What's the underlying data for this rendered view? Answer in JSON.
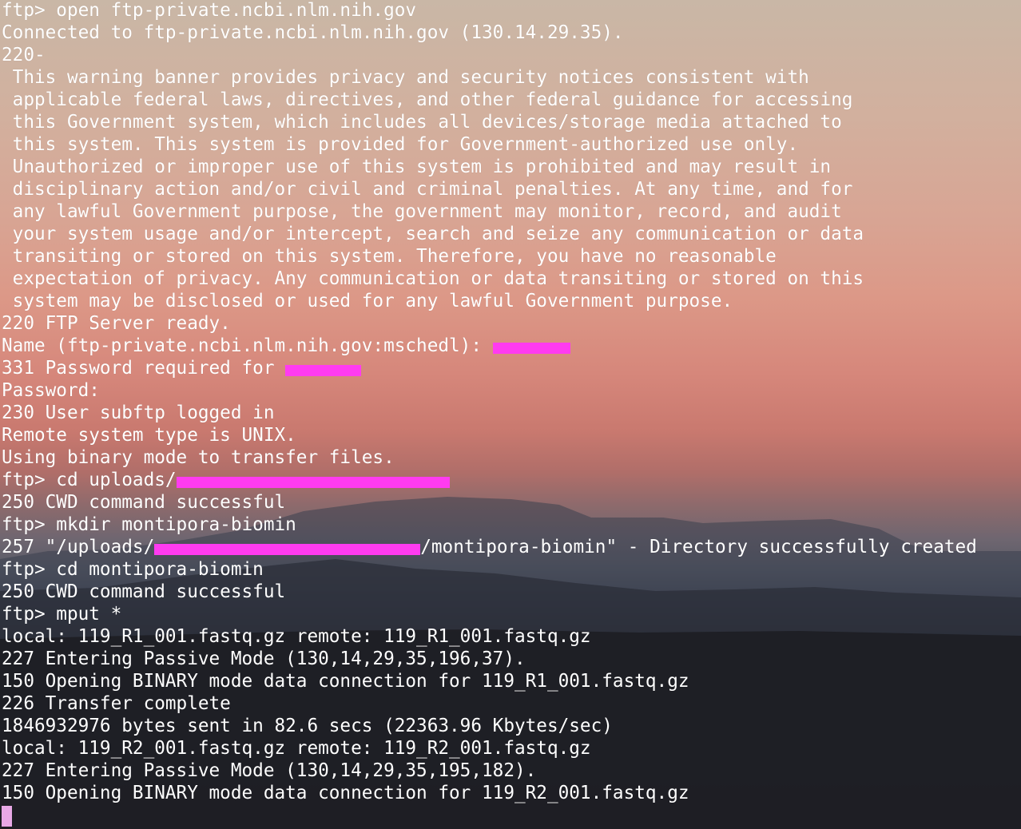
{
  "terminal": {
    "lines": [
      "ftp> open ftp-private.ncbi.nlm.nih.gov",
      "Connected to ftp-private.ncbi.nlm.nih.gov (130.14.29.35).",
      "220-",
      " This warning banner provides privacy and security notices consistent with",
      " applicable federal laws, directives, and other federal guidance for accessing",
      " this Government system, which includes all devices/storage media attached to",
      " this system. This system is provided for Government-authorized use only.",
      " Unauthorized or improper use of this system is prohibited and may result in",
      " disciplinary action and/or civil and criminal penalties. At any time, and for",
      " any lawful Government purpose, the government may monitor, record, and audit",
      " your system usage and/or intercept, search and seize any communication or data",
      " transiting or stored on this system. Therefore, you have no reasonable",
      " expectation of privacy. Any communication or data transiting or stored on this",
      " system may be disclosed or used for any lawful Government purpose.",
      "220 FTP Server ready."
    ],
    "name_prompt": "Name (ftp-private.ncbi.nlm.nih.gov:mschedl): ",
    "password_required": "331 Password required for ",
    "lines2": [
      "Password:",
      "230 User subftp logged in",
      "Remote system type is UNIX.",
      "Using binary mode to transfer files."
    ],
    "cd_uploads": "ftp> cd uploads/",
    "cwd_success_1": "250 CWD command successful",
    "mkdir": "ftp> mkdir montipora-biomin",
    "created_prefix": "257 \"/uploads/",
    "created_suffix": "/montipora-biomin\" - Directory successfully created",
    "lines3": [
      "ftp> cd montipora-biomin",
      "250 CWD command successful",
      "ftp> mput *",
      "local: 119_R1_001.fastq.gz remote: 119_R1_001.fastq.gz",
      "227 Entering Passive Mode (130,14,29,35,196,37).",
      "150 Opening BINARY mode data connection for 119_R1_001.fastq.gz",
      "226 Transfer complete",
      "1846932976 bytes sent in 82.6 secs (22363.96 Kbytes/sec)",
      "local: 119_R2_001.fastq.gz remote: 119_R2_001.fastq.gz",
      "227 Entering Passive Mode (130,14,29,35,195,182).",
      "150 Opening BINARY mode data connection for 119_R2_001.fastq.gz"
    ]
  },
  "colors": {
    "text": "#ffffff",
    "redaction": "#ff3bf0",
    "cursor": "#e8a8e6"
  }
}
